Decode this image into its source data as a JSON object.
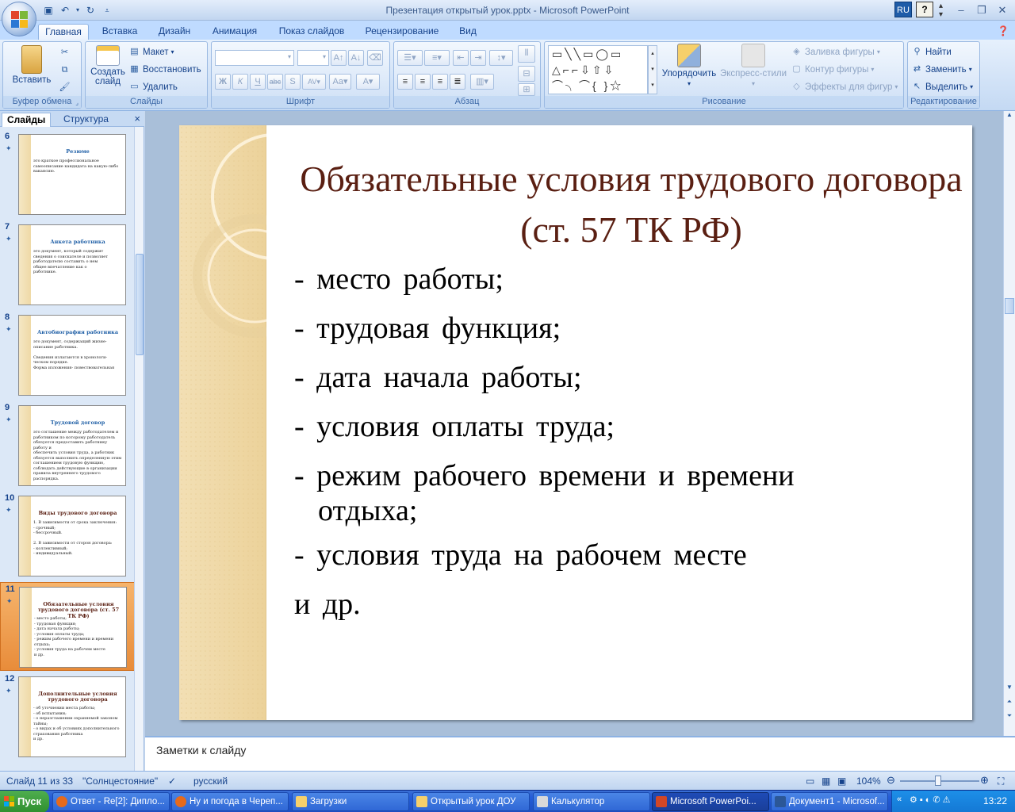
{
  "window": {
    "title": "Презентация открытый урок.pptx - Microsoft PowerPoint",
    "lang": "RU",
    "help": "?"
  },
  "tabs": [
    "Главная",
    "Вставка",
    "Дизайн",
    "Анимация",
    "Показ слайдов",
    "Рецензирование",
    "Вид"
  ],
  "ribbon": {
    "clipboard": {
      "label": "Буфер обмена",
      "paste": "Вставить"
    },
    "slides": {
      "label": "Слайды",
      "new_slide": "Создать слайд",
      "layout": "Макет",
      "reset": "Восстановить",
      "delete": "Удалить"
    },
    "font": {
      "label": "Шрифт",
      "font_name": "",
      "font_size": ""
    },
    "paragraph": {
      "label": "Абзац"
    },
    "drawing": {
      "label": "Рисование",
      "arrange": "Упорядочить",
      "quick_styles": "Экспресс-стили",
      "shape_fill": "Заливка фигуры",
      "shape_outline": "Контур фигуры",
      "shape_effects": "Эффекты для фигур"
    },
    "editing": {
      "label": "Редактирование",
      "find": "Найти",
      "replace": "Заменить",
      "select": "Выделить"
    }
  },
  "left_panel": {
    "tab_slides": "Слайды",
    "tab_outline": "Структура",
    "close": "×"
  },
  "thumbnails": [
    {
      "num": "6",
      "title": "Резюме",
      "body": "это краткое профессиональное\nсамоописание кандидата на какую-либо\nвакансию.",
      "title_color": "#1f5fa6"
    },
    {
      "num": "7",
      "title": "Анкета работника",
      "body": "это документ, который содержит\nсведения о соискателе и позволяет\nработодателю составить о нем\nобщее впечатление как о\nработнике.",
      "title_color": "#1f5fa6"
    },
    {
      "num": "8",
      "title": "Автобиография работника",
      "body": "это документ, содержащий жизне-\nописание работника.\n\nСведения излагаются в хронологи-\nческом порядке.\nФорма изложения- повествовательная",
      "title_color": "#1f5fa6"
    },
    {
      "num": "9",
      "title": "Трудовой договор",
      "body": "это соглашение между работодателем и\nработником по которому работодатель\nобязуется предоставить работнику работу и\nобеспечить условия труда, а работник\nобязуется выполнить определенную этим\nсоглашением трудовую функцию,\nсоблюдать действующие в организации\nправила внутреннего трудового распорядка.",
      "title_color": "#1f5fa6"
    },
    {
      "num": "10",
      "title": "Виды трудового договора",
      "body": "1. В зависимости от срока заключения:\n- срочный;\n- бессрочный.\n\n2. В зависимости от сторон договора:\n- коллективный;\n- индивидуальный.",
      "title_color": "#5a1f12"
    },
    {
      "num": "11",
      "title": "Обязательные условия трудового договора (ст. 57 ТК РФ)",
      "body": "- место работы;\n- трудовая функция;\n- дата начала работы;\n- условия оплаты труда;\n- режим рабочего времени и времени\n  отдыха;\n- условия труда на рабочем месте\nи  др.",
      "title_color": "#5a1f12"
    },
    {
      "num": "12",
      "title": "Дополнительные условия трудового договора",
      "body": "- об уточнении места работы;\n- об испытании;\n- о неразглашении охраняемой законом\n  тайны;\n- о видах и об условиях дополнительного\n  страхования работника\nи др.",
      "title_color": "#5a1f12"
    }
  ],
  "slide": {
    "title": "Обязательные условия трудового договора (ст. 57 ТК РФ)",
    "items": [
      "- место работы;",
      "- трудовая функция;",
      "- дата начала работы;",
      "- условия оплаты труда;",
      "- режим рабочего времени и времени",
      "отдыха;",
      "- условия труда на рабочем месте",
      "и  др."
    ]
  },
  "notes": {
    "placeholder": "Заметки к слайду"
  },
  "status": {
    "slide_info": "Слайд 11 из 33",
    "theme": "\"Солнцестояние\"",
    "language": "русский",
    "zoom": "104%"
  },
  "taskbar": {
    "start": "Пуск",
    "tasks": [
      "Ответ - Re[2]: Дипло...",
      "Ну и погода в Череп...",
      "Загрузки",
      "Открытый урок ДОУ",
      "Калькулятор",
      "Microsoft PowerPoi...",
      "Документ1 - Microsof..."
    ],
    "clock": "13:22"
  }
}
